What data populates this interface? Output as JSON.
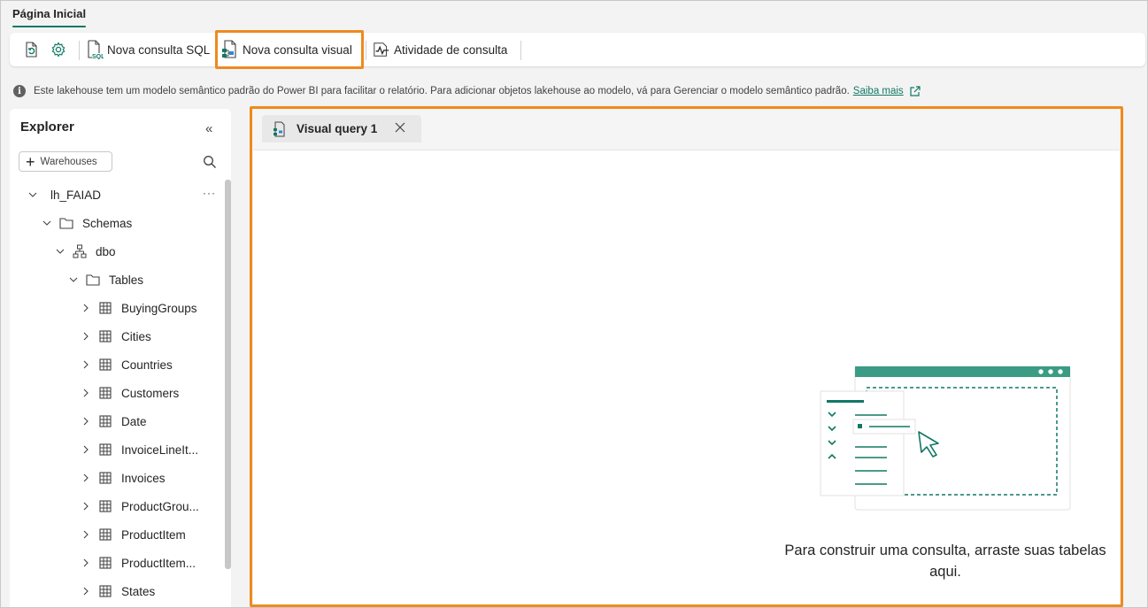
{
  "ribbon": {
    "active_tab": "Página Inicial"
  },
  "toolbar": {
    "refresh_icon": "refresh-icon",
    "settings_icon": "gear-icon",
    "new_sql_query": "Nova consulta SQL",
    "new_visual_query": "Nova consulta visual",
    "query_activity": "Atividade de consulta"
  },
  "infobar": {
    "message": "Este lakehouse tem um modelo semântico padrão do Power BI para facilitar o relatório. Para adicionar objetos lakehouse ao modelo, vá para Gerenciar o modelo semântico padrão.",
    "link": "Saiba mais"
  },
  "explorer": {
    "title": "Explorer",
    "collapse_glyph": "«",
    "add_button": "Warehouses",
    "lakehouse": "lh_FAIAD",
    "more_glyph": "···",
    "schemas": "Schemas",
    "schema_name": "dbo",
    "tables_folder": "Tables",
    "tables": [
      "BuyingGroups",
      "Cities",
      "Countries",
      "Customers",
      "Date",
      "InvoiceLineIt...",
      "Invoices",
      "ProductGrou...",
      "ProductItem",
      "ProductItem...",
      "States"
    ]
  },
  "query": {
    "tab_label": "Visual query 1",
    "empty_message": "Para construir uma consulta, arraste suas tabelas aqui."
  },
  "colors": {
    "accent": "#117865",
    "highlight": "#ef8a1f"
  }
}
